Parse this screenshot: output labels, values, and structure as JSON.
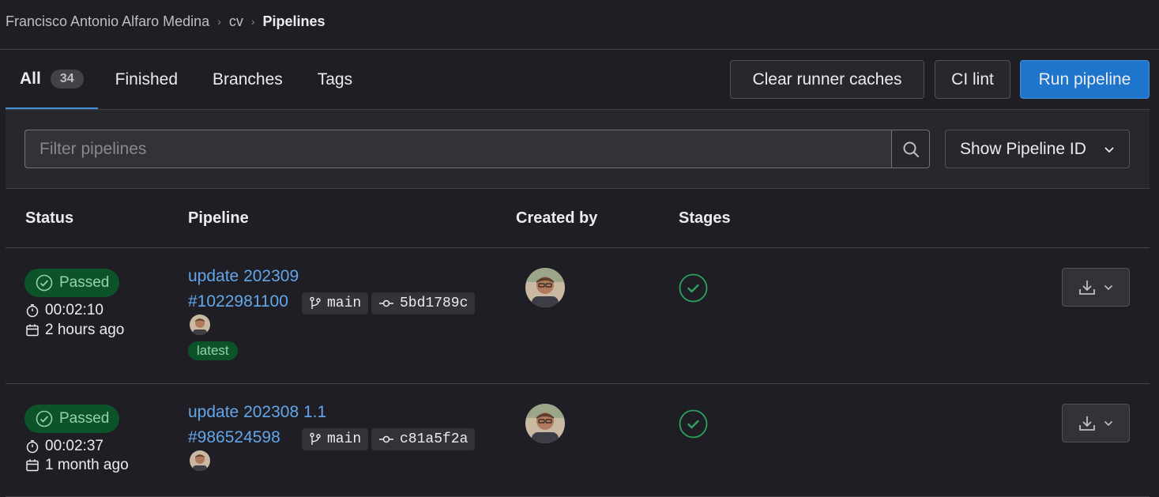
{
  "breadcrumb": {
    "items": [
      "Francisco Antonio Alfaro Medina",
      "cv"
    ],
    "current": "Pipelines"
  },
  "tabs": [
    {
      "label": "All",
      "count": "34",
      "active": true
    },
    {
      "label": "Finished"
    },
    {
      "label": "Branches"
    },
    {
      "label": "Tags"
    }
  ],
  "actions": {
    "clear_caches": "Clear runner caches",
    "ci_lint": "CI lint",
    "run_pipeline": "Run pipeline"
  },
  "filter": {
    "placeholder": "Filter pipelines",
    "dropdown_label": "Show Pipeline ID"
  },
  "table": {
    "headers": [
      "Status",
      "Pipeline",
      "Created by",
      "Stages"
    ]
  },
  "rows": [
    {
      "status": "Passed",
      "duration": "00:02:10",
      "finished": "2 hours ago",
      "title": "update 202309",
      "id": "#1022981100",
      "branch": "main",
      "commit": "5bd1789c",
      "badge": "latest"
    },
    {
      "status": "Passed",
      "duration": "00:02:37",
      "finished": "1 month ago",
      "title": "update 202308 1.1",
      "id": "#986524598",
      "branch": "main",
      "commit": "c81a5f2a"
    }
  ],
  "colors": {
    "background": "#1f1e24",
    "accent": "#1f75cb",
    "link": "#63a6e9",
    "success": "#2da160"
  },
  "icons": [
    "search-icon",
    "chevron-down-icon",
    "check-circle-icon",
    "timer-icon",
    "calendar-icon",
    "branch-icon",
    "commit-icon",
    "download-icon"
  ]
}
